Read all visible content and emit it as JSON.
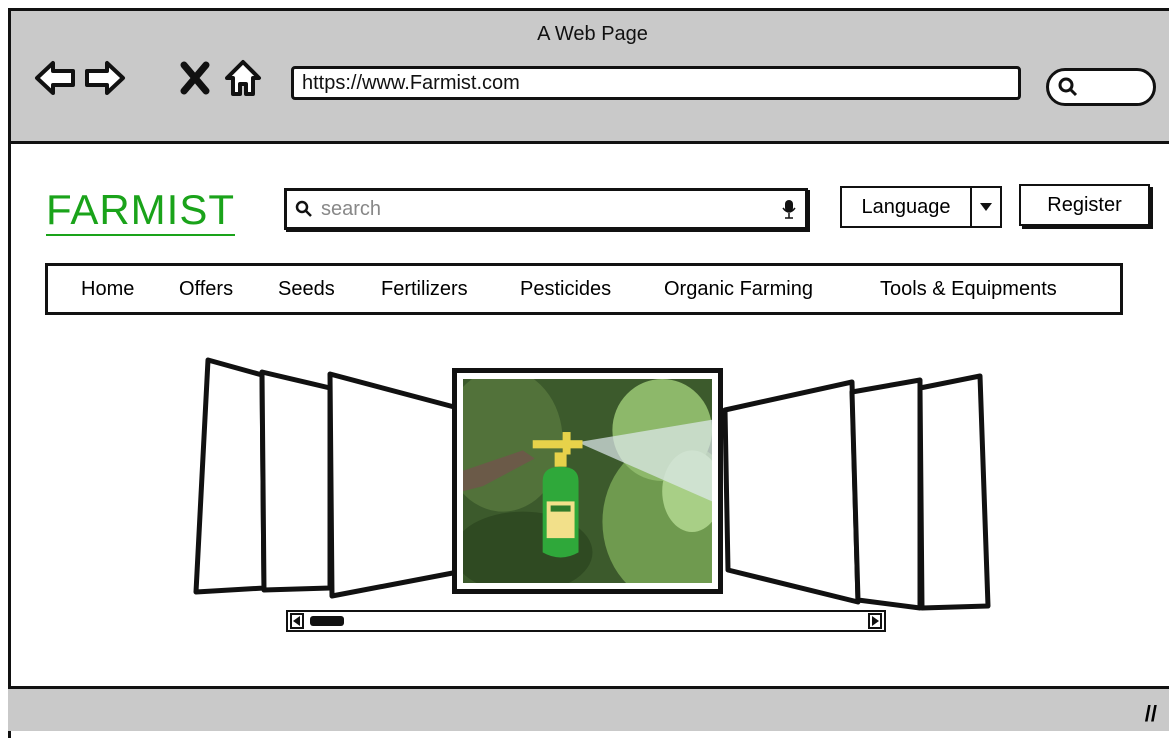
{
  "window": {
    "title": "A Web Page"
  },
  "browser": {
    "url": "https://www.Farmist.com",
    "back_icon": "arrow-left-icon",
    "forward_icon": "arrow-right-icon",
    "stop_icon": "close-icon",
    "home_icon": "home-icon",
    "search_icon": "search-icon"
  },
  "header": {
    "logo": "FARMIST",
    "search_placeholder": "search",
    "language_label": "Language",
    "register_label": "Register"
  },
  "menu": {
    "items": [
      "Home",
      "Offers",
      "Seeds",
      "Fertilizers",
      "Pesticides",
      "Organic Farming",
      "Tools & Equipments"
    ]
  },
  "carousel": {
    "active_image": "pesticide sprayer bottle spraying plants",
    "scroll_position": 0.03
  },
  "colors": {
    "logo": "#1aa31a",
    "chrome": "#c9c9c9"
  }
}
